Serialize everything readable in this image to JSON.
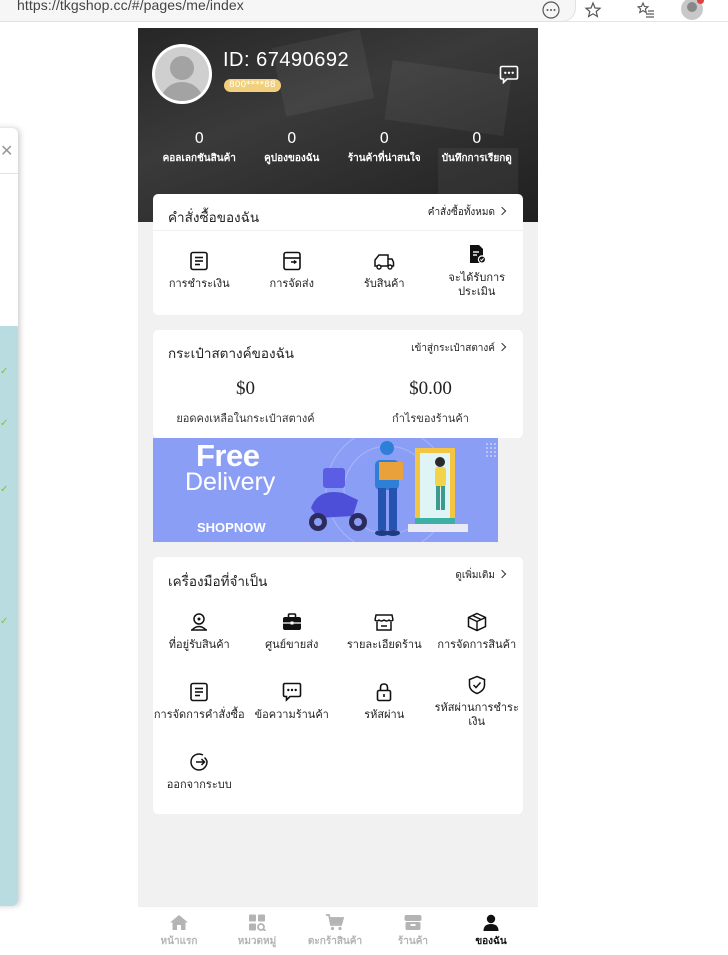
{
  "browser": {
    "url": "https://tkgshop.cc/#/pages/me/index"
  },
  "profile": {
    "id_label": "ID:  67490692",
    "phone_masked": "800****88"
  },
  "stats": [
    {
      "value": "0",
      "label": "คอลเลกชันสินค้า"
    },
    {
      "value": "0",
      "label": "คูปองของฉัน"
    },
    {
      "value": "0",
      "label": "ร้านค้าที่น่าสนใจ"
    },
    {
      "value": "0",
      "label": "บันทึกการเรียกดู"
    }
  ],
  "orders": {
    "title": "คำสั่งซื้อของฉัน",
    "link": "คำสั่งซื้อทั้งหมด",
    "items": [
      {
        "label": "การชำระเงิน",
        "icon": "payment-icon"
      },
      {
        "label": "การจัดส่ง",
        "icon": "shipping-box-icon"
      },
      {
        "label": "รับสินค้า",
        "icon": "truck-icon"
      },
      {
        "label": "จะได้รับการประเมิน",
        "icon": "review-doc-icon"
      }
    ]
  },
  "wallet": {
    "title": "กระเป๋าสตางค์ของฉัน",
    "link": "เข้าสู่กระเป๋าสตางค์",
    "balance_value": "$0",
    "balance_label": "ยอดคงเหลือในกระเป๋าสตางค์",
    "profit_value": "$0.00",
    "profit_label": "กำไรของร้านค้า"
  },
  "banner": {
    "free": "Free",
    "delivery": "Delivery",
    "shopnow": "SHOPNOW"
  },
  "tools": {
    "title": "เครื่องมือที่จำเป็น",
    "link": "ดูเพิ่มเติม",
    "items": [
      {
        "label": "ที่อยู่รับสินค้า",
        "icon": "address-icon"
      },
      {
        "label": "ศูนย์ขายส่ง",
        "icon": "briefcase-icon"
      },
      {
        "label": "รายละเอียดร้าน",
        "icon": "store-icon"
      },
      {
        "label": "การจัดการสินค้า",
        "icon": "package-icon"
      },
      {
        "label": "การจัดการคำสั่งซื้อ",
        "icon": "order-list-icon"
      },
      {
        "label": "ข้อความร้านค้า",
        "icon": "chat-icon"
      },
      {
        "label": "รหัสผ่าน",
        "icon": "lock-icon"
      },
      {
        "label": "รหัสผ่านการชำระเงิน",
        "icon": "shield-icon"
      },
      {
        "label": "ออกจากระบบ",
        "icon": "logout-icon"
      }
    ]
  },
  "tabbar": [
    {
      "label": "หน้าแรก",
      "icon": "home-icon"
    },
    {
      "label": "หมวดหมู่",
      "icon": "category-icon"
    },
    {
      "label": "ตะกร้าสินค้า",
      "icon": "cart-icon"
    },
    {
      "label": "ร้านค้า",
      "icon": "shop-icon"
    },
    {
      "label": "ของฉัน",
      "icon": "user-icon",
      "active": true
    }
  ],
  "colors": {
    "badge": "#f1cf7b",
    "banner": "#8b9ef5",
    "inactive_tab": "#b4b4b4"
  }
}
